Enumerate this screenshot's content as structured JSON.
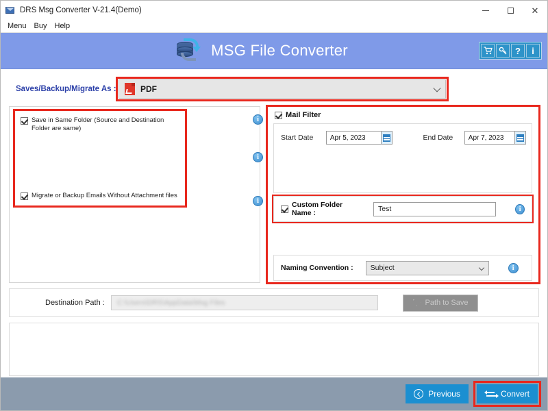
{
  "window": {
    "title": "DRS Msg Converter V-21.4(Demo)",
    "app_icon": "envelope-icon",
    "controls": {
      "minimize": "minimize-icon",
      "maximize": "maximize-icon",
      "close": "close-icon"
    }
  },
  "menubar": {
    "items": [
      "Menu",
      "Buy",
      "Help"
    ]
  },
  "banner": {
    "title": "MSG File Converter",
    "logo_icon": "database-convert-icon",
    "tools": [
      {
        "name": "cart-icon",
        "glyph": "cart"
      },
      {
        "name": "key-icon",
        "glyph": "key"
      },
      {
        "name": "help-icon",
        "glyph": "?"
      },
      {
        "name": "info-icon",
        "glyph": "i"
      }
    ]
  },
  "save_as": {
    "label": "Saves/Backup/Migrate As :",
    "selected": "PDF",
    "icon": "pdf-file-icon",
    "highlighted": true,
    "highlight_color": "#e8281e"
  },
  "left_panel": {
    "options": [
      {
        "label": "Save in Same Folder (Source and Destination Folder are same)",
        "checked": true
      },
      {
        "label": "Migrate or Backup Emails Without Attachment files",
        "checked": true
      }
    ],
    "info_icons": [
      "info-icon",
      "info-icon",
      "info-icon"
    ],
    "highlighted": true
  },
  "mail_filter": {
    "title": "Mail Filter",
    "checked": true,
    "start_date": {
      "label": "Start Date",
      "value": "Apr 5, 2023",
      "picker": "calendar-icon"
    },
    "end_date": {
      "label": "End Date",
      "value": "Apr 7, 2023",
      "picker": "calendar-icon"
    },
    "custom_folder": {
      "label": "Custom Folder Name :",
      "checked": true,
      "value": "Test",
      "info": "info-icon"
    },
    "naming_convention": {
      "label": "Naming Convention :",
      "selected": "Subject",
      "info": "info-icon"
    },
    "highlighted": true
  },
  "destination": {
    "label": "Destination Path :",
    "value": "C:\\Users\\DRS\\AppData\\Msg Files",
    "browse_button": {
      "label": "Path to Save",
      "enabled": false,
      "icon": "folder-icon"
    }
  },
  "footer": {
    "previous": {
      "label": "Previous",
      "icon": "chevron-left-circle-icon"
    },
    "convert": {
      "label": "Convert",
      "icon": "convert-arrows-icon",
      "highlighted": true
    },
    "accent_color": "#1b8fd1",
    "bar_color": "#8b9bad"
  }
}
